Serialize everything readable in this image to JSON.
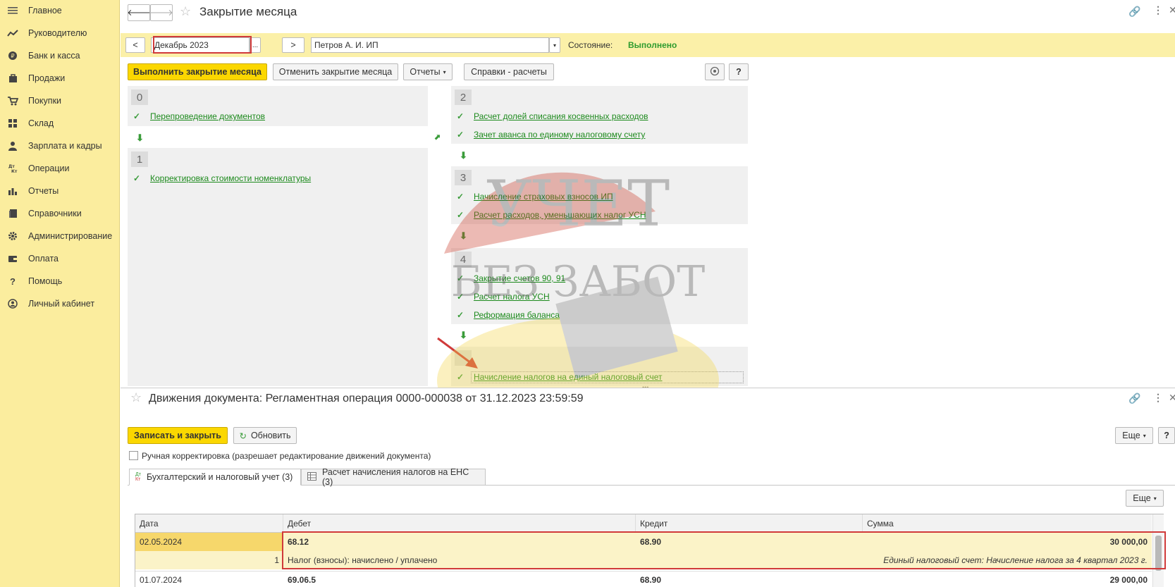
{
  "sidebar": {
    "items": [
      {
        "label": "Главное",
        "icon": "menu-icon"
      },
      {
        "label": "Руководителю",
        "icon": "trend-icon"
      },
      {
        "label": "Банк и касса",
        "icon": "coin-icon"
      },
      {
        "label": "Продажи",
        "icon": "bag-icon"
      },
      {
        "label": "Покупки",
        "icon": "cart-icon"
      },
      {
        "label": "Склад",
        "icon": "warehouse-icon"
      },
      {
        "label": "Зарплата и кадры",
        "icon": "person-icon"
      },
      {
        "label": "Операции",
        "icon": "dt-kt-icon"
      },
      {
        "label": "Отчеты",
        "icon": "bar-chart-icon"
      },
      {
        "label": "Справочники",
        "icon": "book-icon"
      },
      {
        "label": "Администрирование",
        "icon": "gear-icon"
      },
      {
        "label": "Оплата",
        "icon": "wallet-icon"
      },
      {
        "label": "Помощь",
        "icon": "question-icon"
      },
      {
        "label": "Личный кабинет",
        "icon": "user-circle-icon"
      }
    ]
  },
  "top": {
    "title": "Закрытие месяца",
    "period_prev": "<",
    "period_value": "Декабрь 2023",
    "period_picker": "...",
    "period_next": ">",
    "organization": "Петров А. И. ИП",
    "state_label": "Состояние:",
    "state_value": "Выполнено",
    "run_button": "Выполнить закрытие месяца",
    "cancel_button": "Отменить закрытие месяца",
    "reports_button": "Отчеты",
    "refs_button": "Справки - расчеты",
    "help_button": "?",
    "steps": {
      "s0": {
        "num": "0",
        "links": [
          "Перепроведение документов"
        ]
      },
      "s1": {
        "num": "1",
        "links": [
          "Корректировка стоимости номенклатуры"
        ]
      },
      "s2": {
        "num": "2",
        "links": [
          "Расчет долей списания косвенных расходов",
          "Зачет аванса по единому налоговому счету"
        ]
      },
      "s3": {
        "num": "3",
        "links": [
          "Начисление страховых взносов ИП",
          "Расчет расходов, уменьшающих налог УСН"
        ]
      },
      "s4": {
        "num": "4",
        "links": [
          "Закрытие счетов 90, 91",
          "Расчет налога УСН",
          "Реформация баланса"
        ]
      },
      "s5": {
        "num": "",
        "links": [
          "Начисление налогов на единый налоговый счет"
        ]
      }
    }
  },
  "bottom": {
    "title": "Движения документа: Регламентная операция 0000-000038 от 31.12.2023 23:59:59",
    "save_close": "Записать и закрыть",
    "refresh": "Обновить",
    "more": "Еще",
    "help": "?",
    "manual_label": "Ручная корректировка (разрешает редактирование движений документа)",
    "tabs": [
      {
        "label": "Бухгалтерский и налоговый учет (3)"
      },
      {
        "label": "Расчет начисления налогов на ЕНС (3)"
      }
    ],
    "grid_more": "Еще",
    "columns": {
      "date": "Дата",
      "debit": "Дебет",
      "credit": "Кредит",
      "sum": "Сумма"
    },
    "rows": [
      {
        "date": "02.05.2024",
        "debit": "68.12",
        "credit": "68.90",
        "sum": "30 000,00",
        "num": "1",
        "content": "Налог (взносы): начислено / уплачено",
        "comment": "Единый налоговый счет: Начисление налога за 4 квартал 2023 г."
      },
      {
        "date": "01.07.2024",
        "debit": "69.06.5",
        "credit": "68.90",
        "sum": "29 000,00"
      }
    ]
  },
  "watermark": {
    "line1": "УЧЕТ",
    "line2": "БЕЗ ЗАБОТ"
  }
}
